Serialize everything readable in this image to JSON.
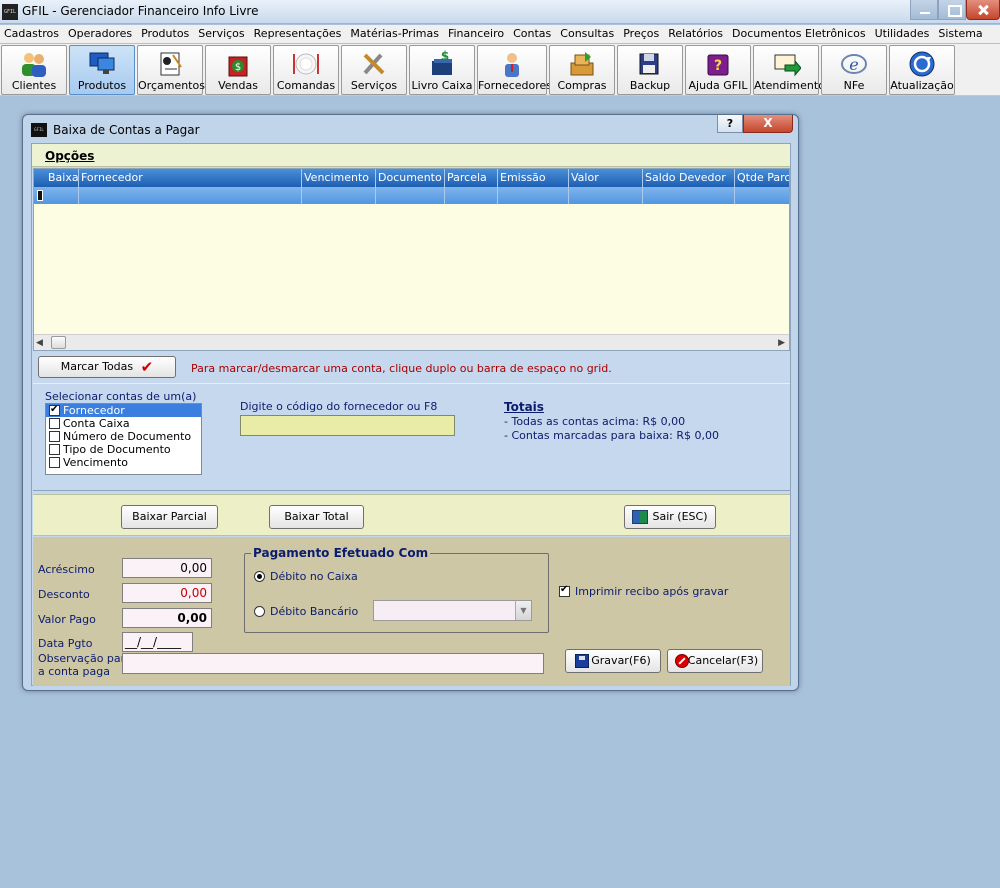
{
  "app": {
    "logo": "GFIL",
    "title": "GFIL - Gerenciador Financeiro Info Livre"
  },
  "menu": [
    "Cadastros",
    "Operadores",
    "Produtos",
    "Serviços",
    "Representações",
    "Matérias-Primas",
    "Financeiro",
    "Contas",
    "Consultas",
    "Preços",
    "Relatórios",
    "Documentos Eletrônicos",
    "Utilidades",
    "Sistema"
  ],
  "toolbar": [
    {
      "label": "Clientes",
      "icon": "users-icon"
    },
    {
      "label": "Produtos",
      "icon": "monitor-icon"
    },
    {
      "label": "Orçamentos",
      "icon": "quote-icon"
    },
    {
      "label": "Vendas",
      "icon": "sales-bag-icon"
    },
    {
      "label": "Comandas",
      "icon": "plate-icon"
    },
    {
      "label": "Serviços",
      "icon": "tools-icon"
    },
    {
      "label": "Livro Caixa",
      "icon": "cashbook-icon"
    },
    {
      "label": "Fornecedores",
      "icon": "supplier-icon"
    },
    {
      "label": "Compras",
      "icon": "boxes-icon"
    },
    {
      "label": "Backup",
      "icon": "floppy-icon"
    },
    {
      "label": "Ajuda GFIL",
      "icon": "help-book-icon"
    },
    {
      "label": "Atendimento",
      "icon": "support-icon"
    },
    {
      "label": "NFe",
      "icon": "nfe-icon"
    },
    {
      "label": "Atualização",
      "icon": "update-icon"
    }
  ],
  "dialog": {
    "title": "Baixa de Contas a Pagar",
    "help": "?",
    "close": "X",
    "options": "Opções",
    "grid_columns": [
      "Baixar",
      "Fornecedor",
      "Vencimento",
      "Documento",
      "Parcela",
      "Emissão",
      "Valor",
      "Saldo Devedor",
      "Qtde Parc."
    ],
    "marcar_todas": "Marcar Todas",
    "mark_check": "✔",
    "mark_hint": "Para marcar/desmarcar uma conta, clique duplo ou barra de espaço no grid.",
    "select_label": "Selecionar contas de um(a)",
    "select_options": [
      "Fornecedor",
      "Conta Caixa",
      "Número de Documento",
      "Tipo de Documento",
      "Vencimento"
    ],
    "code_label": "Digite o código do fornecedor ou F8",
    "code_value": "",
    "totals_title": "Totais",
    "totals_all": "- Todas as contas acima: R$ 0,00",
    "totals_marked": "- Contas marcadas para baixa: R$ 0,00",
    "btn_parcial": "Baixar Parcial",
    "btn_total": "Baixar Total",
    "btn_sair": "Sair (ESC)",
    "acrescimo_label": "Acréscimo",
    "acrescimo_value": "0,00",
    "desconto_label": "Desconto",
    "desconto_value": "0,00",
    "valor_pago_label": "Valor Pago",
    "valor_pago_value": "0,00",
    "data_pgto_label": "Data Pgto",
    "data_pgto_value": "__/__/____",
    "obs_label_1": "Observação para",
    "obs_label_2": "a conta paga",
    "obs_value": "",
    "payment_title": "Pagamento Efetuado Com",
    "payment_caixa": "Débito no Caixa",
    "payment_banco": "Débito Bancário",
    "print_receipt": "Imprimir recibo após gravar",
    "btn_gravar": "Gravar(F6)",
    "btn_cancelar": "Cancelar(F3)"
  }
}
